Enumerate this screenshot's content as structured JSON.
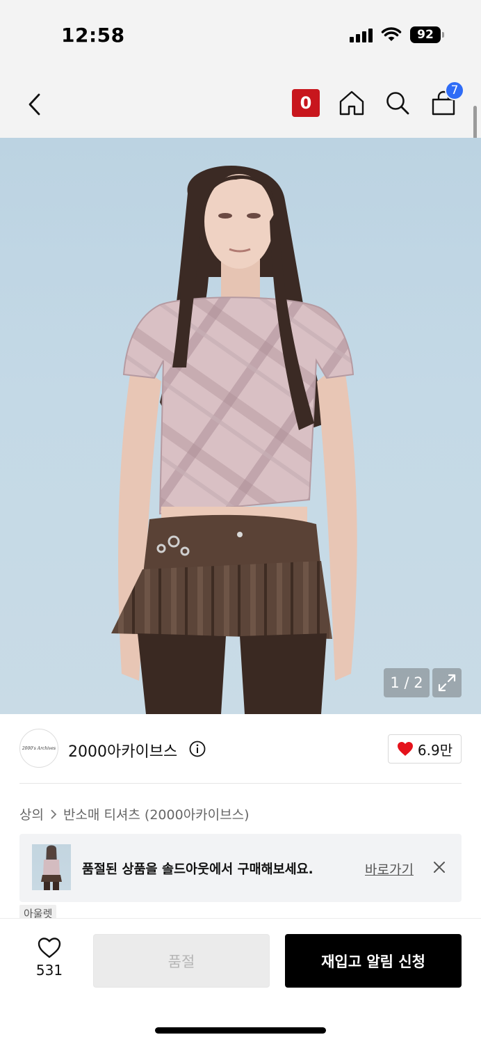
{
  "status_bar": {
    "time": "12:58",
    "battery": "92"
  },
  "nav": {
    "o_badge": "0",
    "cart_count": "7"
  },
  "gallery": {
    "counter": "1 / 2"
  },
  "brand": {
    "logo_text": "2000's Archives",
    "name": "2000아카이브스",
    "likes": "6.9만"
  },
  "breadcrumb": {
    "level1": "상의",
    "level2": "반소매 티셔츠 (2000아카이브스)"
  },
  "soldout_banner": {
    "message": "품절된 상품을 솔드아웃에서 구매해보세요.",
    "link": "바로가기"
  },
  "tag": {
    "label": "아울렛"
  },
  "bottom": {
    "wish_count": "531",
    "soldout_label": "품절",
    "restock_label": "재입고 알림 신청"
  },
  "colors": {
    "accent_red": "#c8161d",
    "cart_badge_blue": "#2f6cf6",
    "primary_button": "#000000"
  }
}
